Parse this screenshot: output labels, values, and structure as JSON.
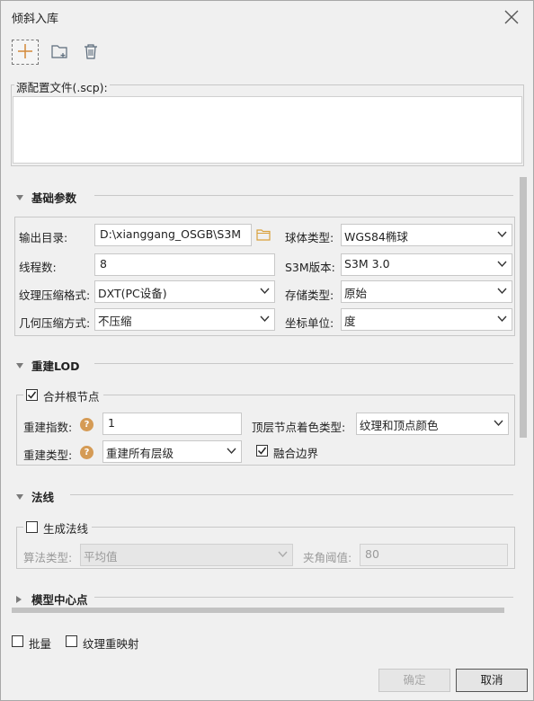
{
  "window": {
    "title": "倾斜入库"
  },
  "toolbar": {
    "add_icon": "plus-icon",
    "folder_icon": "folder-add-icon",
    "delete_icon": "trash-icon"
  },
  "source": {
    "label": "源配置文件(.scp):",
    "value": ""
  },
  "basic": {
    "title": "基础参数",
    "output_dir_label": "输出目录:",
    "output_dir_value": "D:\\xianggang_OSGB\\S3M",
    "threads_label": "线程数:",
    "threads_value": "8",
    "texture_label": "纹理压缩格式:",
    "texture_value": "DXT(PC设备)",
    "geometry_label": "几何压缩方式:",
    "geometry_value": "不压缩",
    "ellipsoid_label": "球体类型:",
    "ellipsoid_value": "WGS84椭球",
    "s3m_label": "S3M版本:",
    "s3m_value": "S3M 3.0",
    "storage_label": "存储类型:",
    "storage_value": "原始",
    "unit_label": "坐标单位:",
    "unit_value": "度"
  },
  "lod": {
    "title": "重建LOD",
    "merge_label": "合并根节点",
    "merge_checked": true,
    "index_label": "重建指数:",
    "index_value": "1",
    "type_label": "重建类型:",
    "type_value": "重建所有层级",
    "top_color_label": "顶层节点着色类型:",
    "top_color_value": "纹理和顶点颜色",
    "blend_label": "融合边界",
    "blend_checked": true,
    "help_glyph": "?"
  },
  "normal": {
    "title": "法线",
    "generate_label": "生成法线",
    "generate_checked": false,
    "algo_label": "算法类型:",
    "algo_value": "平均值",
    "angle_label": "夹角阈值:",
    "angle_value": "80"
  },
  "model_center": {
    "title": "模型中心点"
  },
  "bottom": {
    "batch_label": "批量",
    "batch_checked": false,
    "remap_label": "纹理重映射",
    "remap_checked": false
  },
  "buttons": {
    "ok": "确定",
    "cancel": "取消"
  },
  "colors": {
    "help": "#d59b55",
    "folder": "#d9a13b",
    "toolbar_icon": "#5a6a7a"
  }
}
